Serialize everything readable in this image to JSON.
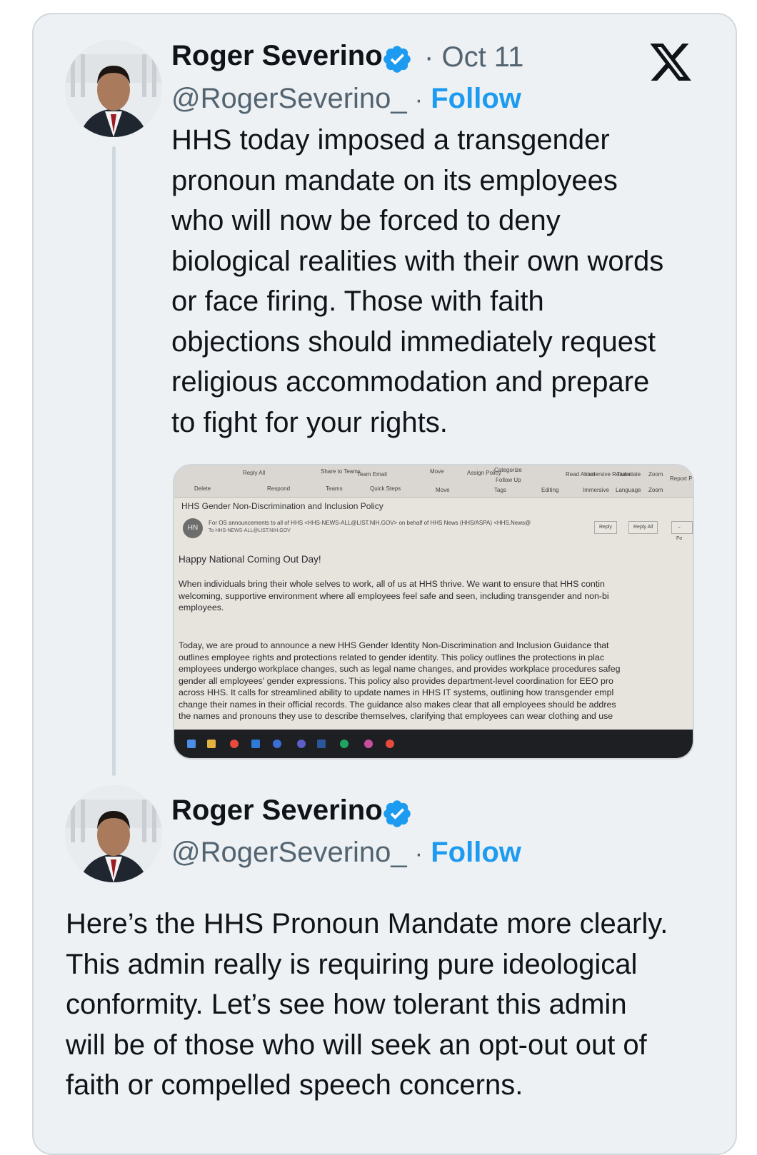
{
  "tweet1": {
    "name": "Roger Severino",
    "date_sep": "·",
    "date": "Oct 11",
    "handle": "@RogerSeverino_",
    "follow_sep": "·",
    "follow_label": "Follow",
    "text_lines": [
      "HHS today imposed a transgender",
      "pronoun mandate on its employees",
      "who will now be forced to deny",
      "biological realities with their own words",
      "or face firing. Those with faith",
      "objections should immediately request",
      "religious accommodation and prepare",
      "to fight for your rights."
    ]
  },
  "tweet2": {
    "name": "Roger Severino",
    "handle": "@RogerSeverino_",
    "follow_sep": "·",
    "follow_label": "Follow",
    "text_lines": [
      "Here’s the HHS Pronoun Mandate more clearly.",
      "This admin really is requiring pure ideological",
      "conformity. Let’s see how tolerant this admin",
      "will be of those who will seek an opt-out out of",
      "faith or compelled speech concerns."
    ]
  },
  "screenshot": {
    "ribbon": {
      "delete": "Delete",
      "reply_all": "Reply All",
      "respond": "Respond",
      "share_to_teams": "Share to Teams",
      "teams": "Teams",
      "team_email": "Team Email",
      "quick_steps": "Quick Steps",
      "move": "Move",
      "assign_policy": "Assign Policy",
      "categorize": "Categorize",
      "follow_up": "Follow Up",
      "tags": "Tags",
      "editing": "Editing",
      "read_aloud": "Read Aloud",
      "immersive_reader": "Immersive Reader",
      "immersive": "Immersive",
      "translate": "Translate",
      "language": "Language",
      "zoom": "Zoom",
      "report_phishing": "Report Phishing"
    },
    "subject": "HHS Gender Non-Discrimination and Inclusion Policy",
    "avatar_initials": "HN",
    "from": "For OS announcements to all of HHS <HHS-NEWS-ALL@LIST.NIH.GOV> on behalf of HHS News (HHS/ASPA) <HHS.News@",
    "to": "To  HHS-NEWS-ALL@LIST.NIH.GOV",
    "reply": "Reply",
    "reply_all": "Reply All",
    "forward": "→ Fo",
    "greeting": "Happy National Coming Out Day!",
    "para1": [
      "When individuals bring their whole selves to work, all of us at HHS thrive.  We want to ensure that HHS contin",
      "welcoming, supportive environment where all employees feel safe and seen, including transgender and non-bi",
      "employees."
    ],
    "para2": [
      "Today, we are proud to announce a new HHS Gender Identity Non-Discrimination and Inclusion Guidance that",
      "outlines employee rights and protections related to gender identity.  This policy outlines the protections in plac",
      "employees undergo workplace changes, such as legal name changes, and provides workplace procedures safeg",
      "gender all employees' gender expressions.  This policy also provides department-level coordination for EEO pro",
      "across HHS.  It calls for streamlined ability to update names in HHS IT systems, outlining how transgender empl",
      "change their names in their official records.  The guidance also makes clear that all employees should be addres",
      "the names and pronouns they use to describe themselves, clarifying that employees can wear clothing and use"
    ]
  },
  "colors": {
    "link_blue": "#1d9bf0",
    "muted_gray": "#536471",
    "text": "#0f1419",
    "card_bg": "#eef1f4",
    "verified_blue": "#1d9bf0"
  },
  "icons": {
    "verified": "verified-badge-icon",
    "x_logo": "x-logo-icon"
  }
}
